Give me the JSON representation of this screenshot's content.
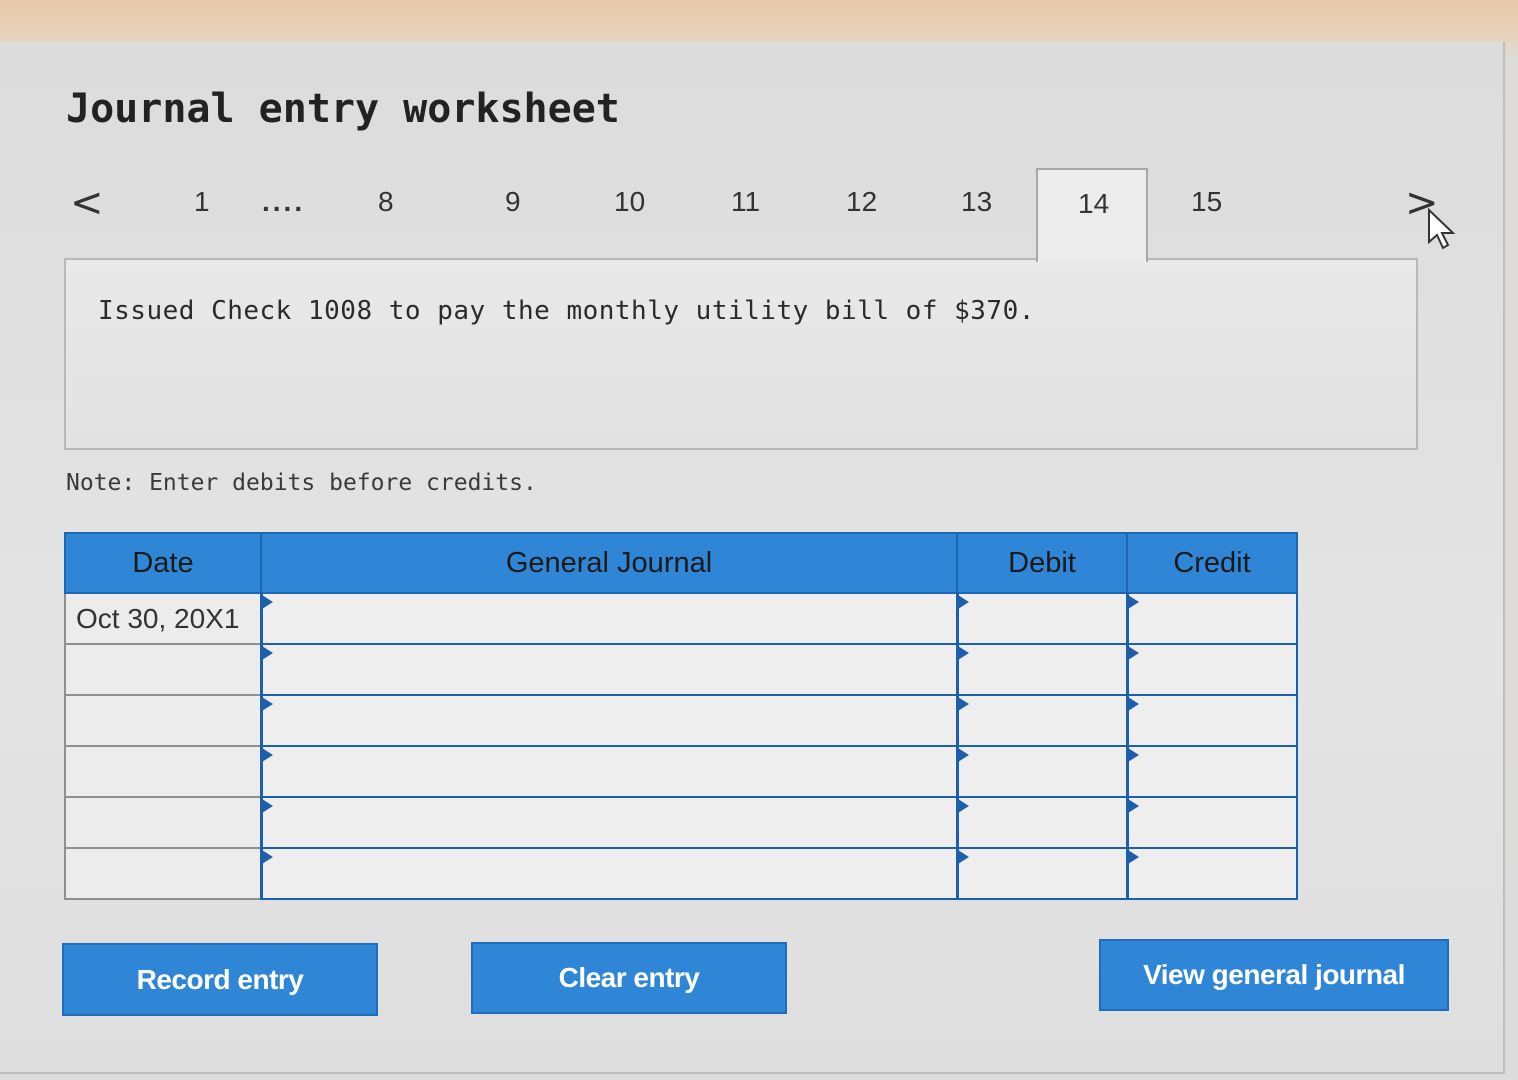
{
  "worksheet": {
    "title": "Journal entry worksheet"
  },
  "nav": {
    "prev_icon": "chevron-left-icon",
    "next_icon": "chevron-right-icon",
    "prev_glyph": "<",
    "next_glyph": ">",
    "tabs": [
      "1",
      "....",
      "8",
      "9",
      "10",
      "11",
      "12",
      "13",
      "14",
      "15"
    ],
    "active_tab": "14"
  },
  "question": {
    "text": "Issued Check 1008 to pay the monthly utility bill of $370."
  },
  "note": "Note: Enter debits before credits.",
  "journal": {
    "headers": {
      "date": "Date",
      "general_journal": "General Journal",
      "debit": "Debit",
      "credit": "Credit"
    },
    "rows": [
      {
        "date": "Oct 30, 20X1",
        "account": "",
        "debit": "",
        "credit": ""
      },
      {
        "date": "",
        "account": "",
        "debit": "",
        "credit": ""
      },
      {
        "date": "",
        "account": "",
        "debit": "",
        "credit": ""
      },
      {
        "date": "",
        "account": "",
        "debit": "",
        "credit": ""
      },
      {
        "date": "",
        "account": "",
        "debit": "",
        "credit": ""
      },
      {
        "date": "",
        "account": "",
        "debit": "",
        "credit": ""
      }
    ]
  },
  "buttons": {
    "record": "Record entry",
    "clear": "Clear entry",
    "view": "View general journal"
  },
  "colors": {
    "accent": "#2f86d6",
    "accent_border": "#1d5fa9",
    "background": "#dcdcdc"
  }
}
